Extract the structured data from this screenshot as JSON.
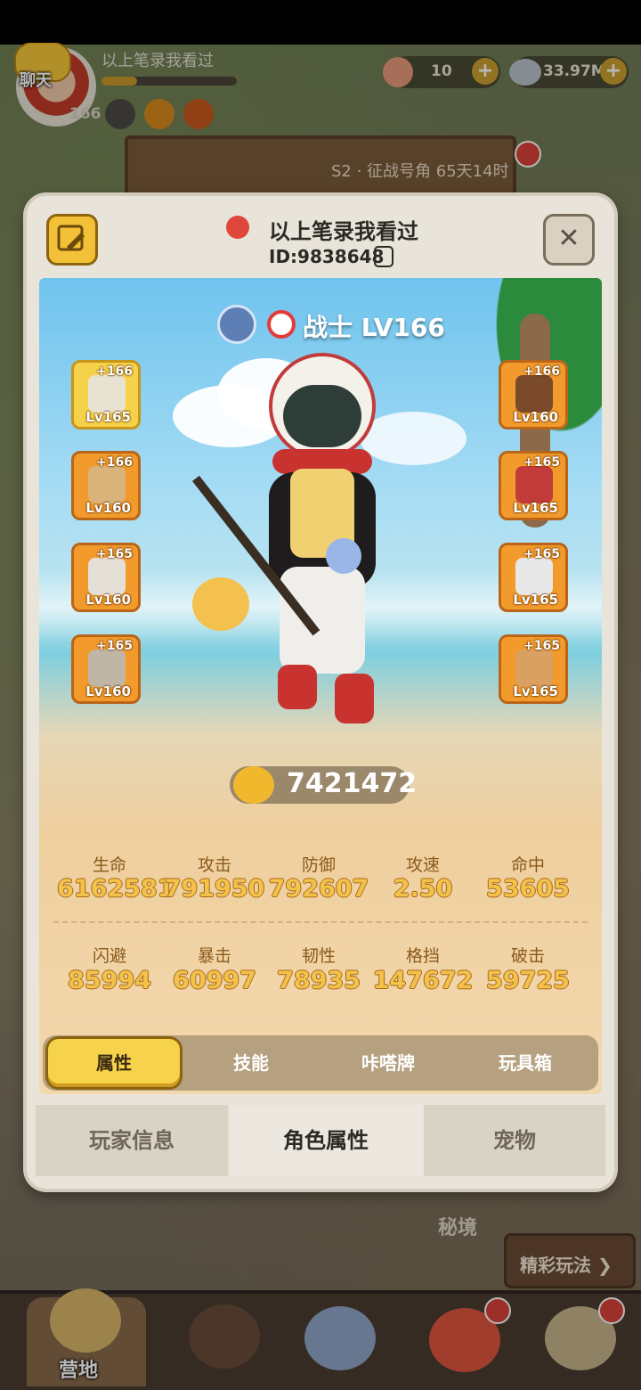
{
  "hud": {
    "chat_label": "聊天",
    "player_name": "以上笔录我看过",
    "level": "166",
    "resource_1_value": "10",
    "resource_2_value": "33.97M",
    "plus_glyph": "+",
    "season_text": "S2 · 征战号角 65天14时"
  },
  "background_labels": {
    "secret_realm": "秘境",
    "featured_play": "精彩玩法 ❯"
  },
  "bottom_nav": {
    "camp_label": "营地",
    "icons": [
      "camp-icon",
      "hero-icon",
      "battle-icon",
      "pet-icon",
      "monster-icon"
    ]
  },
  "modal": {
    "player_name": "以上笔录我看过",
    "player_id": "ID:9838648",
    "close_glyph": "✕",
    "class_text": "战士 LV166",
    "power": "7421472",
    "left_equipment": [
      {
        "plus": "+166",
        "level": "Lv165",
        "frame": "gold"
      },
      {
        "plus": "+166",
        "level": "Lv160",
        "frame": "orange"
      },
      {
        "plus": "+165",
        "level": "Lv160",
        "frame": "orange"
      },
      {
        "plus": "+165",
        "level": "Lv160",
        "frame": "orange"
      }
    ],
    "right_equipment": [
      {
        "plus": "+166",
        "level": "Lv160",
        "frame": "orange"
      },
      {
        "plus": "+165",
        "level": "Lv165",
        "frame": "orange"
      },
      {
        "plus": "+165",
        "level": "Lv165",
        "frame": "orange"
      },
      {
        "plus": "+165",
        "level": "Lv165",
        "frame": "orange"
      }
    ],
    "stats_row1": [
      {
        "label": "生命",
        "value": "6162581"
      },
      {
        "label": "攻击",
        "value": "791950"
      },
      {
        "label": "防御",
        "value": "792607"
      },
      {
        "label": "攻速",
        "value": "2.50"
      },
      {
        "label": "命中",
        "value": "53605"
      }
    ],
    "stats_row2": [
      {
        "label": "闪避",
        "value": "85994"
      },
      {
        "label": "暴击",
        "value": "60997"
      },
      {
        "label": "韧性",
        "value": "78935"
      },
      {
        "label": "格挡",
        "value": "147672"
      },
      {
        "label": "破击",
        "value": "59725"
      }
    ],
    "attr_tabs": [
      "属性",
      "技能",
      "咔嗒牌",
      "玩具箱"
    ],
    "attr_tab_selected": "属性",
    "bottom_tabs": [
      "玩家信息",
      "角色属性",
      "宠物"
    ],
    "bottom_tab_selected": "角色属性"
  },
  "colors": {
    "stat_gold": "#f2c24b",
    "active_tab": "#f6d34a",
    "equip_orange": "#f29b2c",
    "equip_gold": "#f6d24a"
  }
}
